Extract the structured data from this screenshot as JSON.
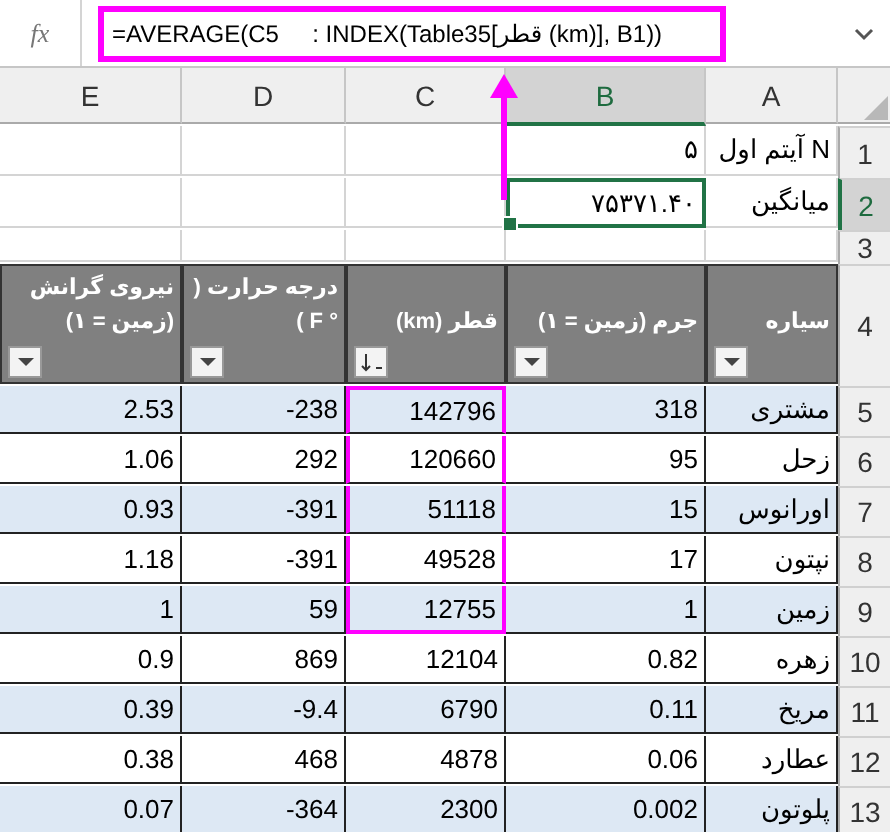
{
  "formula_bar": {
    "fx": "fx",
    "formula": "=AVERAGE(C5     : INDEX(Table35[قطر (km)], B1))",
    "highlighted": true
  },
  "columns": [
    {
      "label": "A",
      "selected": false
    },
    {
      "label": "B",
      "selected": true
    },
    {
      "label": "C",
      "selected": false
    },
    {
      "label": "D",
      "selected": false
    },
    {
      "label": "E",
      "selected": false
    }
  ],
  "rows": [
    {
      "number": "1",
      "selected": false,
      "cells": [
        {
          "text": "N آیتم اول",
          "selected": false
        },
        {
          "text": "۵",
          "selected": false
        }
      ]
    },
    {
      "number": "2",
      "selected": true,
      "cells": [
        {
          "text": "میانگین",
          "selected": false
        },
        {
          "text": "۷۵۳۷۱.۴۰",
          "selected": true
        }
      ]
    },
    {
      "number": "3",
      "selected": false,
      "cells": []
    }
  ],
  "table": {
    "header_number": "4",
    "columns": [
      {
        "label": "سیاره",
        "kind": "filter"
      },
      {
        "label": "جرم (زمین = ۱)",
        "kind": "filter"
      },
      {
        "label": "قطر (km)",
        "kind": "sort"
      },
      {
        "label": "درجه حرارت ( ° F )",
        "kind": "filter"
      },
      {
        "label": "نیروی گرانش (زمین = ۱)",
        "kind": "filter"
      }
    ],
    "rows": [
      {
        "number": "5",
        "banded": true,
        "in_range": true,
        "cells": [
          "مشتری",
          "318",
          "142796",
          "-238",
          "2.53"
        ]
      },
      {
        "number": "6",
        "banded": false,
        "in_range": true,
        "cells": [
          "زحل",
          "95",
          "120660",
          "292",
          "1.06"
        ]
      },
      {
        "number": "7",
        "banded": true,
        "in_range": true,
        "cells": [
          "اورانوس",
          "15",
          "51118",
          "-391",
          "0.93"
        ]
      },
      {
        "number": "8",
        "banded": false,
        "in_range": true,
        "cells": [
          "نپتون",
          "17",
          "49528",
          "-391",
          "1.18"
        ]
      },
      {
        "number": "9",
        "banded": true,
        "in_range": true,
        "cells": [
          "زمین",
          "1",
          "12755",
          "59",
          "1"
        ]
      },
      {
        "number": "10",
        "banded": false,
        "in_range": false,
        "cells": [
          "زهره",
          "0.82",
          "12104",
          "869",
          "0.9"
        ]
      },
      {
        "number": "11",
        "banded": true,
        "in_range": false,
        "cells": [
          "مریخ",
          "0.11",
          "6790",
          "-9.4",
          "0.39"
        ]
      },
      {
        "number": "12",
        "banded": false,
        "in_range": false,
        "cells": [
          "عطارد",
          "0.06",
          "4878",
          "468",
          "0.38"
        ]
      },
      {
        "number": "13",
        "banded": true,
        "in_range": false,
        "cells": [
          "پلوتون",
          "0.002",
          "2300",
          "-364",
          "0.07"
        ]
      }
    ]
  }
}
